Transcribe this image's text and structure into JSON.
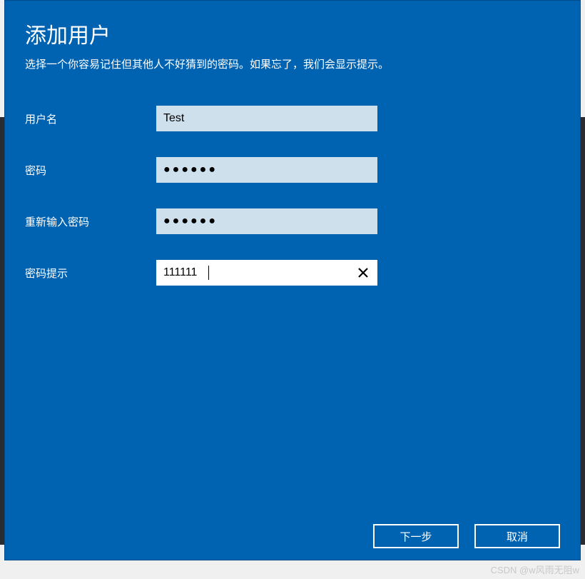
{
  "dialog": {
    "title": "添加用户",
    "subtitle": "选择一个你容易记住但其他人不好猜到的密码。如果忘了，我们会显示提示。"
  },
  "fields": {
    "username": {
      "label": "用户名",
      "value": "Test"
    },
    "password": {
      "label": "密码",
      "value": "●●●●●●"
    },
    "password_confirm": {
      "label": "重新输入密码",
      "value": "●●●●●●"
    },
    "password_hint": {
      "label": "密码提示",
      "value": "111111"
    }
  },
  "icons": {
    "clear": "close-icon"
  },
  "buttons": {
    "next": "下一步",
    "cancel": "取消"
  },
  "watermark": "CSDN @w风雨无阻w"
}
